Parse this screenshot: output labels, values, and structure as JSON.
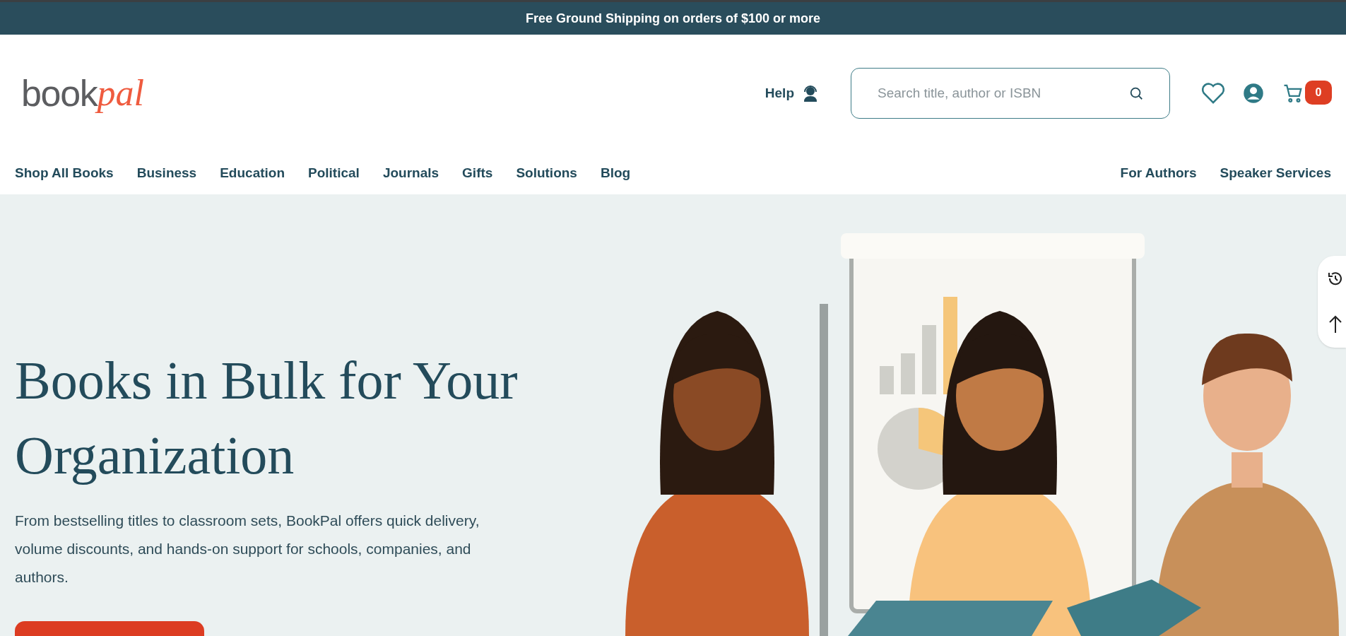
{
  "banner": {
    "text": "Free Ground Shipping on orders of $100 or more"
  },
  "logo": {
    "part_1": "book",
    "part_2": "pal"
  },
  "header": {
    "help": "Help",
    "search": {
      "placeholder": "Search title, author or ISBN"
    },
    "cart_count": "0"
  },
  "nav": {
    "left": [
      "Shop All Books",
      "Business",
      "Education",
      "Political",
      "Journals",
      "Gifts",
      "Solutions",
      "Blog"
    ],
    "right": [
      "For Authors",
      "Speaker Services"
    ]
  },
  "hero": {
    "heading": "Books in Bulk for Your Organization",
    "text": "From bestselling titles to classroom sets, BookPal offers quick delivery, volume discounts, and hands-on support for schools, companies, and authors."
  }
}
